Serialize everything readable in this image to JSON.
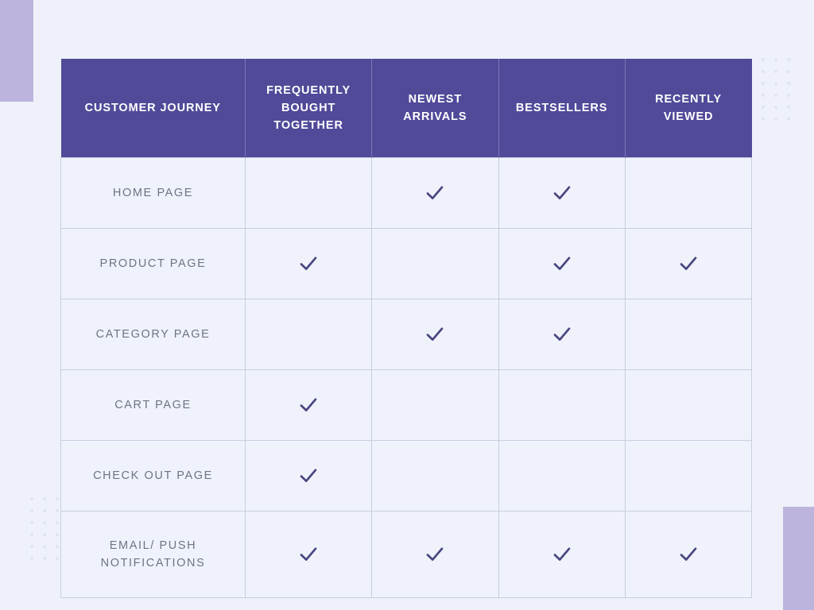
{
  "theme": {
    "page_background": "#EFF1FA",
    "header_purple": "#504A99",
    "accent_lavender": "#BDB4DD",
    "check_color": "#4A4580",
    "row_label_color": "#6F7385",
    "cell_background": "#EFF2FA",
    "cell_border": "#C9CDDF"
  },
  "table": {
    "columns": [
      {
        "id": "customer-journey",
        "label": "CUSTOMER JOURNEY"
      },
      {
        "id": "frequently-bought-together",
        "label": "FREQUENTLY BOUGHT TOGETHER"
      },
      {
        "id": "newest-arrivals",
        "label": "NEWEST ARRIVALS"
      },
      {
        "id": "bestsellers",
        "label": "BESTSELLERS"
      },
      {
        "id": "recently-viewed",
        "label": "RECENTLY VIEWED"
      }
    ],
    "rows": [
      {
        "id": "home-page",
        "label": "HOME PAGE",
        "values": [
          false,
          true,
          true,
          false
        ]
      },
      {
        "id": "product-page",
        "label": "PRODUCT PAGE",
        "values": [
          true,
          false,
          true,
          true
        ]
      },
      {
        "id": "category-page",
        "label": "CATEGORY PAGE",
        "values": [
          false,
          true,
          true,
          false
        ]
      },
      {
        "id": "cart-page",
        "label": "CART PAGE",
        "values": [
          true,
          false,
          false,
          false
        ]
      },
      {
        "id": "check-out-page",
        "label": "CHECK OUT PAGE",
        "values": [
          true,
          false,
          false,
          false
        ]
      },
      {
        "id": "email-push-notifications",
        "label": "EMAIL/ PUSH NOTIFICATIONS",
        "values": [
          true,
          true,
          true,
          true
        ]
      }
    ],
    "check_icon_name": "checkmark-icon"
  },
  "decorations": {
    "top_left_block": "lavender-rectangle",
    "bottom_right_block": "lavender-rectangle",
    "dot_grid_top_right": "dot-grid",
    "dot_grid_bottom_left": "dot-grid",
    "dot_grid_columns": 3,
    "dot_grid_rows": 6
  }
}
